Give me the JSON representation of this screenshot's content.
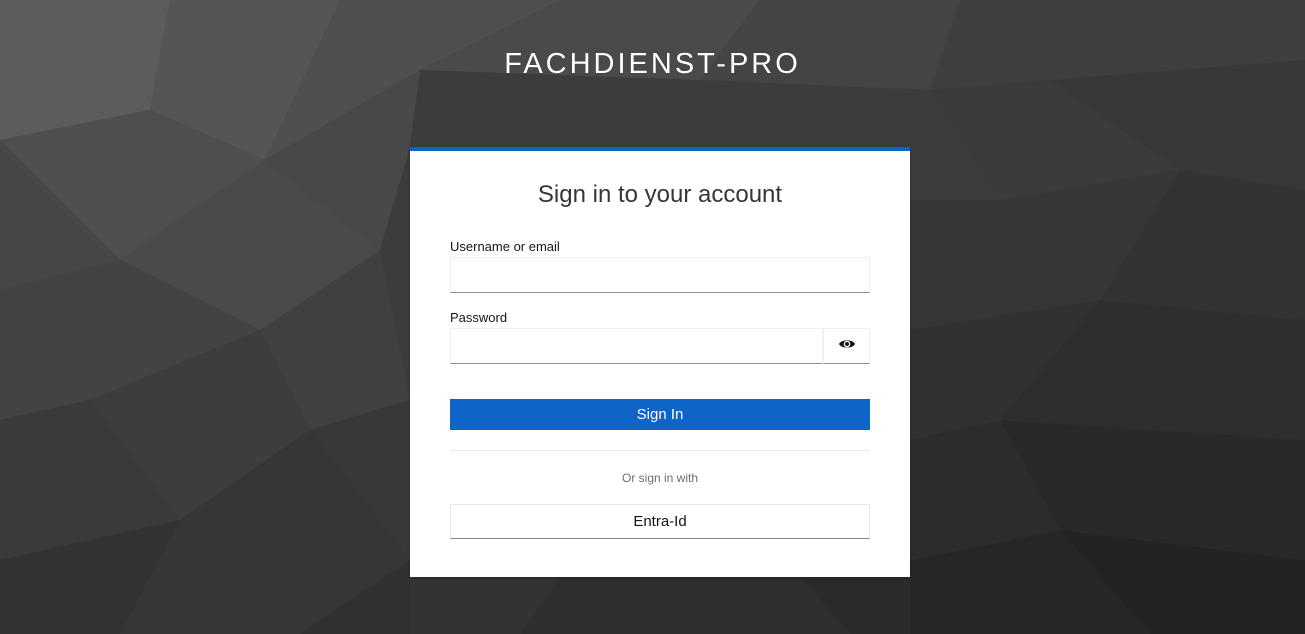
{
  "header": {
    "realm_name": "FACHDIENST-PRO"
  },
  "login": {
    "title": "Sign in to your account",
    "username_label": "Username or email",
    "username_value": "",
    "password_label": "Password",
    "password_value": "",
    "show_password_icon": "eye-icon",
    "submit_label": "Sign In"
  },
  "social": {
    "separator_text": "Or sign in with",
    "providers": [
      {
        "label": "Entra-Id"
      }
    ]
  },
  "colors": {
    "accent": "#0f65c7",
    "background": "#3a3a3a"
  }
}
